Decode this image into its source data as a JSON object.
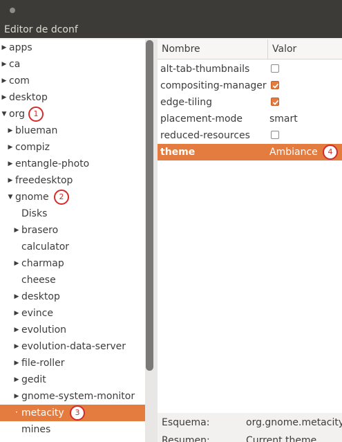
{
  "window": {
    "title": "Editor de dconf"
  },
  "tree": {
    "items": [
      {
        "label": "apps",
        "expander": "collapsed",
        "level": 0
      },
      {
        "label": "ca",
        "expander": "collapsed",
        "level": 0
      },
      {
        "label": "com",
        "expander": "collapsed",
        "level": 0
      },
      {
        "label": "desktop",
        "expander": "collapsed",
        "level": 0
      },
      {
        "label": "org",
        "expander": "expanded",
        "level": 0,
        "marker": "1"
      },
      {
        "label": "blueman",
        "expander": "collapsed",
        "level": 1
      },
      {
        "label": "compiz",
        "expander": "collapsed",
        "level": 1
      },
      {
        "label": "entangle-photo",
        "expander": "collapsed",
        "level": 1
      },
      {
        "label": "freedesktop",
        "expander": "collapsed",
        "level": 1
      },
      {
        "label": "gnome",
        "expander": "expanded",
        "level": 1,
        "marker": "2"
      },
      {
        "label": "Disks",
        "expander": "none",
        "level": 2
      },
      {
        "label": "brasero",
        "expander": "collapsed",
        "level": 2
      },
      {
        "label": "calculator",
        "expander": "none",
        "level": 2
      },
      {
        "label": "charmap",
        "expander": "collapsed",
        "level": 2
      },
      {
        "label": "cheese",
        "expander": "none",
        "level": 2
      },
      {
        "label": "desktop",
        "expander": "collapsed",
        "level": 2
      },
      {
        "label": "evince",
        "expander": "collapsed",
        "level": 2
      },
      {
        "label": "evolution",
        "expander": "collapsed",
        "level": 2
      },
      {
        "label": "evolution-data-server",
        "expander": "collapsed",
        "level": 2
      },
      {
        "label": "file-roller",
        "expander": "collapsed",
        "level": 2
      },
      {
        "label": "gedit",
        "expander": "collapsed",
        "level": 2
      },
      {
        "label": "gnome-system-monitor",
        "expander": "collapsed",
        "level": 2
      },
      {
        "label": "metacity",
        "expander": "collapsed",
        "level": 2,
        "selected": true,
        "marker": "3"
      },
      {
        "label": "mines",
        "expander": "none",
        "level": 2
      }
    ]
  },
  "list": {
    "columns": {
      "name": "Nombre",
      "value": "Valor"
    },
    "rows": [
      {
        "key": "alt-tab-thumbnails",
        "type": "bool",
        "checked": false
      },
      {
        "key": "compositing-manager",
        "type": "bool",
        "checked": true
      },
      {
        "key": "edge-tiling",
        "type": "bool",
        "checked": true
      },
      {
        "key": "placement-mode",
        "type": "text",
        "value": "smart"
      },
      {
        "key": "reduced-resources",
        "type": "bool",
        "checked": false
      },
      {
        "key": "theme",
        "type": "text",
        "value": "Ambiance",
        "selected": true,
        "marker": "4"
      }
    ]
  },
  "details": {
    "schema_label": "Esquema:",
    "schema_value": "org.gnome.metacity",
    "summary_label": "Resumen:",
    "summary_value": "Current theme"
  },
  "colors": {
    "accent": "#e47c3f",
    "titlebar": "#3c3b37",
    "marker": "#d42a2a"
  }
}
